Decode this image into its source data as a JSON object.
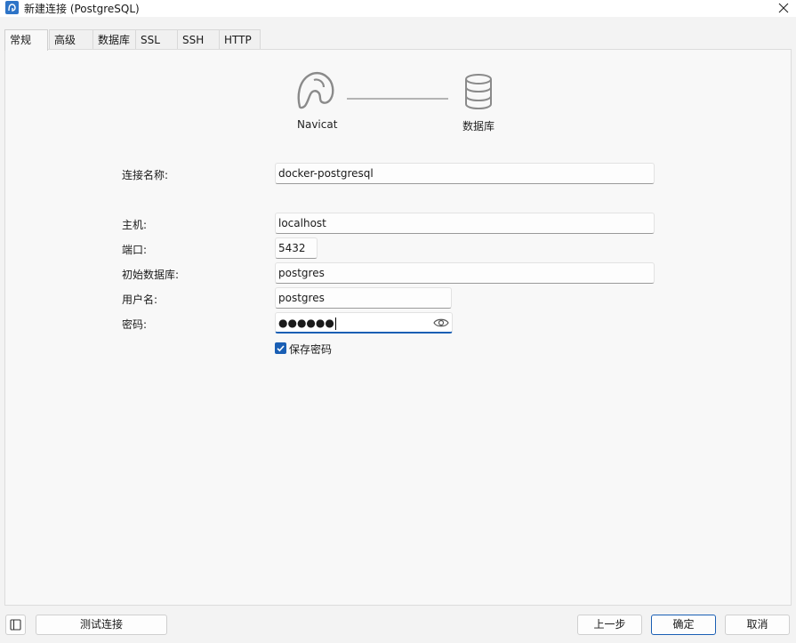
{
  "window": {
    "title": "新建连接 (PostgreSQL)"
  },
  "tabs": [
    {
      "label": "常规",
      "active": true
    },
    {
      "label": "高级"
    },
    {
      "label": "数据库"
    },
    {
      "label": "SSL"
    },
    {
      "label": "SSH"
    },
    {
      "label": "HTTP"
    }
  ],
  "diagram": {
    "left_label": "Navicat",
    "right_label": "数据库"
  },
  "form": {
    "connection_name": {
      "label": "连接名称:",
      "value": "docker-postgresql"
    },
    "host": {
      "label": "主机:",
      "value": "localhost"
    },
    "port": {
      "label": "端口:",
      "value": "5432"
    },
    "initial_db": {
      "label": "初始数据库:",
      "value": "postgres"
    },
    "username": {
      "label": "用户名:",
      "value": "postgres"
    },
    "password": {
      "label": "密码:",
      "masked_value": "●●●●●●"
    },
    "save_password": {
      "label": "保存密码",
      "checked": true
    }
  },
  "buttons": {
    "test": "测试连接",
    "prev": "上一步",
    "ok": "确定",
    "cancel": "取消"
  },
  "colors": {
    "accent": "#1a5fb4",
    "icon_gray": "#8a8a8a"
  }
}
